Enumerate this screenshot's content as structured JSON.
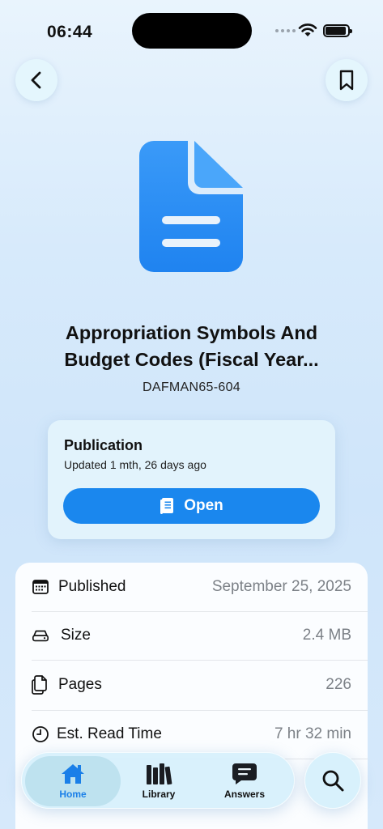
{
  "status_bar": {
    "time": "06:44"
  },
  "document": {
    "title_line1": "Appropriation Symbols And",
    "title_line2": "Budget Codes (Fiscal Year...",
    "code": "DAFMAN65-604"
  },
  "publication_card": {
    "title": "Publication",
    "updated": "Updated 1 mth, 26 days ago",
    "open_label": "Open"
  },
  "details": [
    {
      "icon": "calendar-icon",
      "label": "Published",
      "value": "September 25, 2025"
    },
    {
      "icon": "drive-icon",
      "label": "Size",
      "value": "2.4 MB"
    },
    {
      "icon": "pages-icon",
      "label": "Pages",
      "value": "226"
    },
    {
      "icon": "clock-icon",
      "label": "Est. Read Time",
      "value": "7 hr 32 min"
    }
  ],
  "tab_bar": {
    "tabs": [
      {
        "label": "Home",
        "icon": "house-icon",
        "active": true
      },
      {
        "label": "Library",
        "icon": "books-icon",
        "active": false
      },
      {
        "label": "Answers",
        "icon": "chat-bubble-icon",
        "active": false
      }
    ]
  },
  "colors": {
    "accent": "#1a87ee",
    "icon_blue": "#2b8ef6",
    "secondary_text": "#7c8187"
  }
}
